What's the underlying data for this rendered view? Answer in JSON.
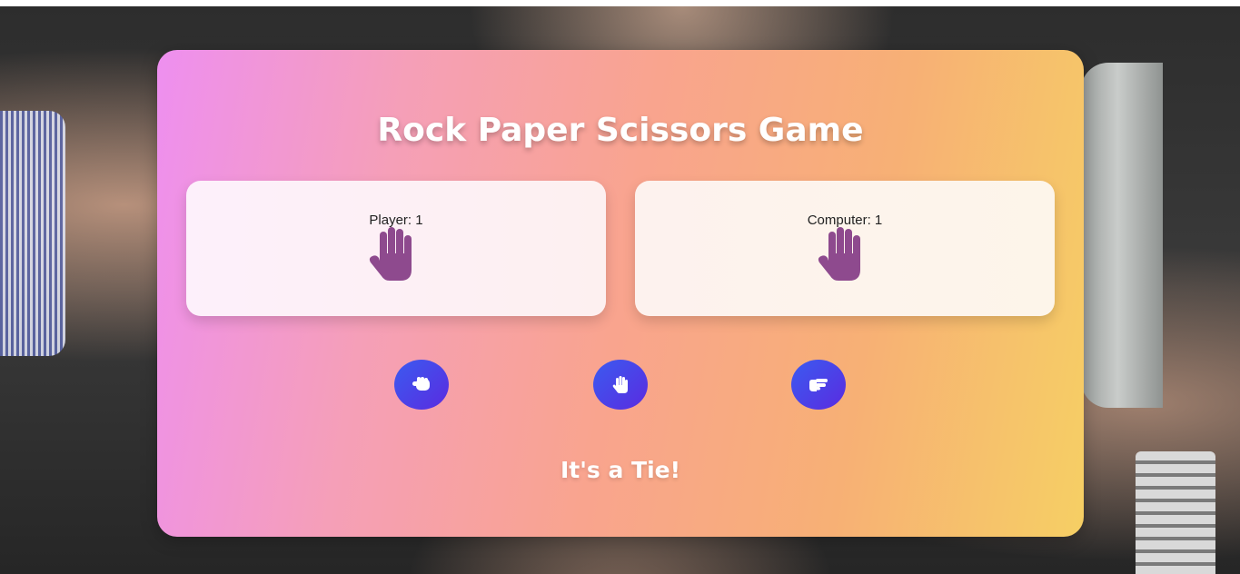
{
  "game": {
    "title": "Rock Paper Scissors Game",
    "result": "It's a Tie!"
  },
  "player": {
    "label": "Player: 1",
    "choice_icon": "paper-hand-icon"
  },
  "computer": {
    "label": "Computer: 1",
    "choice_icon": "paper-hand-icon"
  },
  "controls": [
    {
      "choice": "rock",
      "icon": "fist-icon"
    },
    {
      "choice": "paper",
      "icon": "open-hand-icon"
    },
    {
      "choice": "scissors",
      "icon": "scissors-hand-icon"
    }
  ],
  "colors": {
    "hand": "#8e4a8e",
    "button_start": "#3b5bf0",
    "button_end": "#5a2be0"
  }
}
